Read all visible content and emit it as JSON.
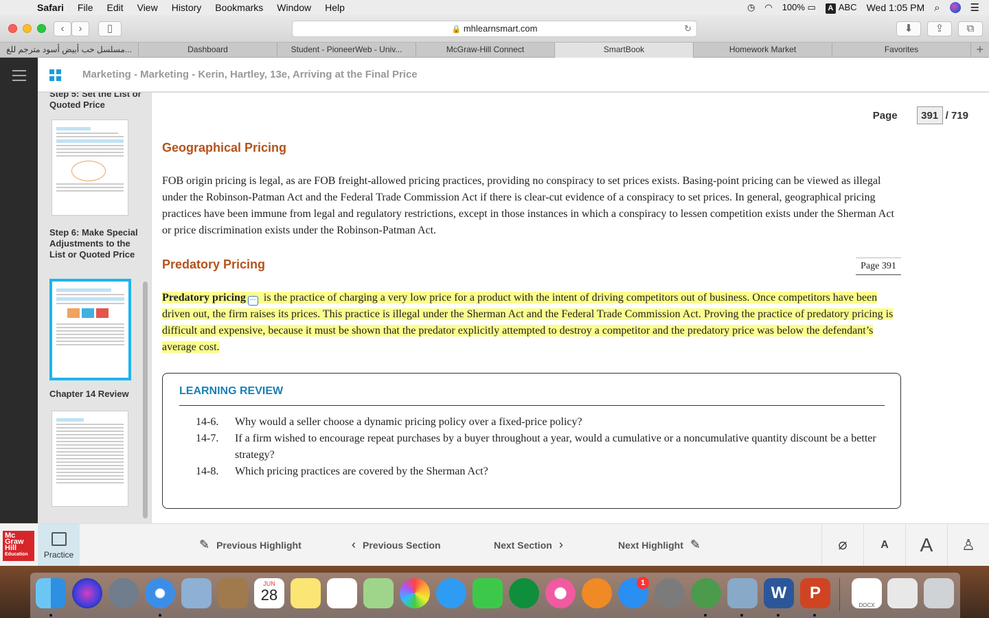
{
  "menubar": {
    "app": "Safari",
    "items": [
      "File",
      "Edit",
      "View",
      "History",
      "Bookmarks",
      "Window",
      "Help"
    ],
    "battery": "100%",
    "input_badge": "A",
    "input_source": "ABC",
    "clock": "Wed 1:05 PM"
  },
  "browser": {
    "url": "mhlearnsmart.com",
    "tabs": [
      "مسلسل حب أبيض أسود مترجم للغ...",
      "Dashboard",
      "Student - PioneerWeb - Univ...",
      "McGraw-Hill Connect",
      "SmartBook",
      "Homework Market",
      "Favorites"
    ],
    "new_tab_symbol": "+"
  },
  "header": {
    "breadcrumb": "Marketing - Marketing - Kerin, Hartley, 13e, Arriving at the Final Price"
  },
  "sidebar": {
    "items": [
      {
        "title": "Step 5: Set the List or Quoted Price"
      },
      {
        "title": "Step 6: Make Special Adjustments  to the List or Quoted Price"
      },
      {
        "title": "Chapter 14 Review"
      }
    ]
  },
  "pager": {
    "label": "Page",
    "current": "391",
    "total": "/ 719"
  },
  "content": {
    "section1_heading": "Geographical Pricing",
    "section1_text": "FOB origin pricing is legal, as are FOB freight-allowed pricing practices, providing no conspiracy to set prices exists. Basing-point pricing can be viewed as illegal under the Robinson-Patman Act and the Federal Trade Commission Act if there is clear-cut evidence of a conspiracy to set prices. In general, geographical pricing practices have been immune from legal and regulatory restrictions, except in those instances in which a conspiracy to lessen competition exists under the Sherman Act or price discrimination exists under the Robinson-Patman Act.",
    "page_marker": "Page 391",
    "section2_heading": "Predatory Pricing",
    "section2_term": "Predatory pricing",
    "section2_text": " is the practice of charging a very low price for a product with the intent of driving competitors out of business. Once competitors have been driven out, the firm raises its prices. This practice is illegal under the Sherman Act and the Federal Trade Commission Act. Proving the practice of predatory pricing is difficult and expensive, because it must be shown that the predator explicitly attempted to destroy a competitor and the predatory price was below the defendant’s average cost.",
    "review": {
      "title": "LEARNING REVIEW",
      "questions": [
        {
          "num": "14-6.",
          "text": "Why would a seller choose a dynamic pricing policy over a fixed-price policy?"
        },
        {
          "num": "14-7.",
          "text": "If a firm wished to encourage repeat purchases by a buyer throughout a year, would a cumulative or a noncumulative quantity discount be a better strategy?"
        },
        {
          "num": "14-8.",
          "text": "Which pricing practices are covered by the Sherman Act?"
        }
      ]
    }
  },
  "footer": {
    "logo_lines": [
      "Mc",
      "Graw",
      "Hill",
      "Education"
    ],
    "practice_label": "Practice",
    "prev_highlight": "Previous Highlight",
    "prev_section": "Previous Section",
    "next_section": "Next Section",
    "next_highlight": "Next Highlight",
    "font_small": "A",
    "font_large": "A"
  },
  "dock": {
    "calendar_month": "JUN",
    "calendar_day": "28",
    "appstore_badge": "1",
    "docx_label": "DOCX"
  },
  "colors": {
    "heading": "#b5521a",
    "highlight": "#fbfd8c",
    "accent": "#1bb5ec",
    "review_title": "#1a7fb5"
  }
}
